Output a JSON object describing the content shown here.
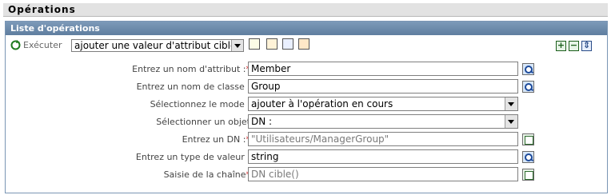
{
  "header": {
    "title": "Opérations"
  },
  "panel": {
    "title": "Liste d'opérations"
  },
  "toolbar": {
    "execute_label": "Exécuter",
    "operation_select": "ajouter une valeur d'attribut cible",
    "icons": [
      "refresh-icon",
      "properties-icon",
      "cut-icon",
      "copy-icon",
      "paste-icon",
      "add-icon",
      "remove-icon",
      "move-icon"
    ]
  },
  "rows": [
    {
      "label": "Entrez un nom d'attribut :",
      "required": "*",
      "value": "Member",
      "placeholder": false,
      "side_icon": "search-icon"
    },
    {
      "label": "Entrez un nom de classe :",
      "required": "",
      "value": "Group",
      "placeholder": false,
      "side_icon": "search-icon"
    },
    {
      "label": "Sélectionnez le mode :",
      "required": "",
      "value": "ajouter à l'opération en cours",
      "type": "select"
    },
    {
      "label": "Sélectionner un objet",
      "required": "",
      "value": "DN :",
      "type": "select"
    },
    {
      "label": "Entrez un DN :",
      "required": "*",
      "value": "\"Utilisateurs/ManagerGroup\"",
      "placeholder": true,
      "side_icon": "editor-icon"
    },
    {
      "label": "Entrez un type de valeur :",
      "required": "",
      "value": "string",
      "placeholder": false,
      "side_icon": "search-icon"
    },
    {
      "label": "Saisie de la chaîne",
      "required": "*",
      "value": "DN cible()",
      "placeholder": true,
      "side_icon": "editor-icon"
    }
  ]
}
